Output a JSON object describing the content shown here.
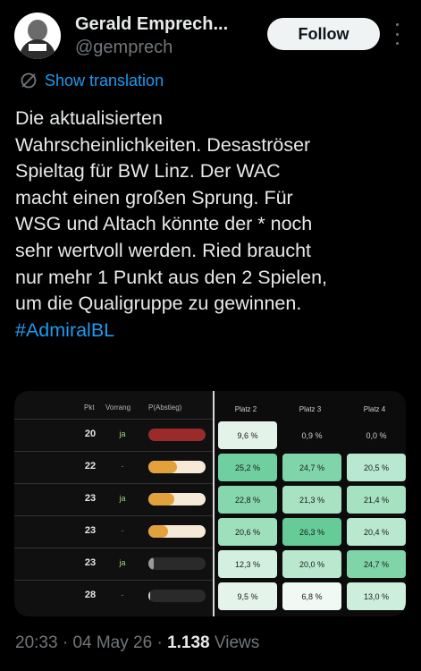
{
  "tweet": {
    "author_name": "Gerald Emprech...",
    "author_handle": "@gemprech",
    "follow_label": "Follow",
    "translate_label": "Show translation",
    "text": "Die aktualisierten\nWahrscheinlichkeiten. Desaströser\nSpieltag für BW Linz. Der WAC\nmacht einen großen Sprung. Für\nWSG und Altach könnte der * noch\nsehr wertvoll werden. Ried braucht\nnur mehr 1 Punkt aus den 2 Spielen,\num die Qualigruppe zu gewinnen.",
    "hashtag": "#AdmiralBL",
    "time": "20:33",
    "date": "04 May 26",
    "views_count": "1.138",
    "views_label": "Views",
    "separator": "·"
  },
  "table": {
    "headers": {
      "pkt": "Pkt",
      "vorrang": "Vorrang",
      "abstieg": "P(Abstieg)",
      "platz2": "Platz 2",
      "platz3": "Platz 3",
      "platz4": "Platz 4"
    },
    "rows": [
      {
        "pkt": "20",
        "vorrang": "ja",
        "abstieg": 1.0,
        "bar_color": "#9b2b2b",
        "track": "dark",
        "p2": "9,6 %",
        "p3": "0,9 %",
        "p4": "0,0 %",
        "c2": "#e3f3ea",
        "c3": "plain",
        "c4": "plain"
      },
      {
        "pkt": "22",
        "vorrang": "-",
        "abstieg": 0.5,
        "bar_color": "#e3a13c",
        "track": "light",
        "p2": "25,2 %",
        "p3": "24,7 %",
        "p4": "20,5 %",
        "c2": "#6fcf9e",
        "c3": "#7fd5a9",
        "c4": "#b8e8cf"
      },
      {
        "pkt": "23",
        "vorrang": "ja",
        "abstieg": 0.45,
        "bar_color": "#e3a13c",
        "track": "light",
        "p2": "22,8 %",
        "p3": "21,3 %",
        "p4": "21,4 %",
        "c2": "#86d7ad",
        "c3": "#a8e2c3",
        "c4": "#a6e1c2"
      },
      {
        "pkt": "23",
        "vorrang": "-",
        "abstieg": 0.35,
        "bar_color": "#e3a13c",
        "track": "light",
        "p2": "20,6 %",
        "p3": "26,3 %",
        "p4": "20,4 %",
        "c2": "#9ee0bc",
        "c3": "#66cc97",
        "c4": "#b9e8cf"
      },
      {
        "pkt": "23",
        "vorrang": "ja",
        "abstieg": 0.1,
        "bar_color": "#9a9a9a",
        "track": "dark",
        "p2": "12,3 %",
        "p3": "20,0 %",
        "p4": "24,7 %",
        "c2": "#d2efdf",
        "c3": "#b9e8ce",
        "c4": "#7fd4a8"
      },
      {
        "pkt": "28",
        "vorrang": "-",
        "abstieg": 0.03,
        "bar_color": "#cfcfcf",
        "track": "dark",
        "p2": "9,5 %",
        "p3": "6,8 %",
        "p4": "13,0 %",
        "c2": "#e4f4eb",
        "c3": "#f1f9f4",
        "c4": "#cdeedb"
      }
    ]
  }
}
